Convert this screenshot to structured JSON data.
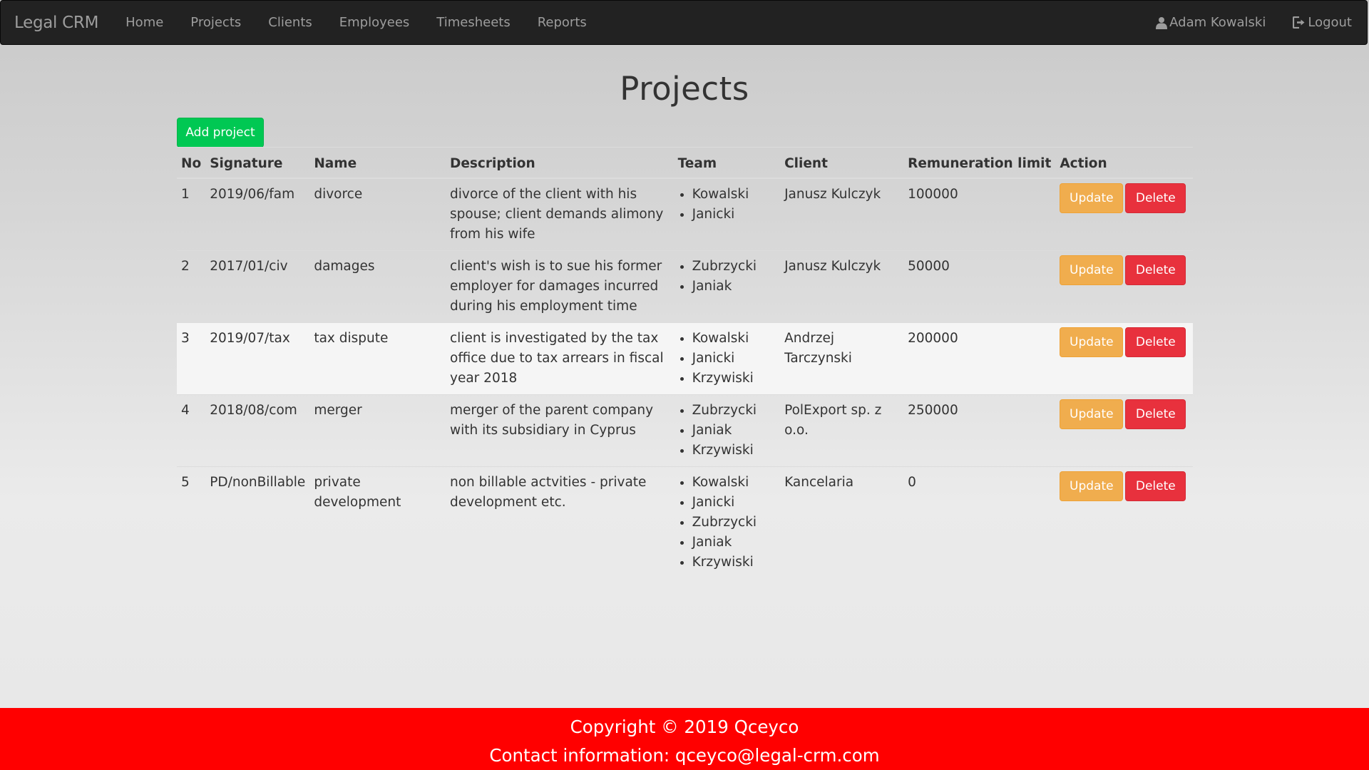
{
  "navbar": {
    "brand": "Legal CRM",
    "links": [
      "Home",
      "Projects",
      "Clients",
      "Employees",
      "Timesheets",
      "Reports"
    ],
    "user_name": "Adam Kowalski",
    "logout_label": "Logout"
  },
  "page": {
    "title": "Projects",
    "add_button_label": "Add project"
  },
  "table": {
    "headers": [
      "No",
      "Signature",
      "Name",
      "Description",
      "Team",
      "Client",
      "Remuneration limit",
      "Action"
    ],
    "rows": [
      {
        "no": "1",
        "signature": "2019/06/fam",
        "name": "divorce",
        "description": "divorce of the client with his spouse; client demands alimony from his wife",
        "team": [
          "Kowalski",
          "Janicki"
        ],
        "client": "Janusz Kulczyk",
        "limit": "100000"
      },
      {
        "no": "2",
        "signature": "2017/01/civ",
        "name": "damages",
        "description": "client's wish is to sue his former employer for damages incurred during his employment time",
        "team": [
          "Zubrzycki",
          "Janiak"
        ],
        "client": "Janusz Kulczyk",
        "limit": "50000"
      },
      {
        "no": "3",
        "signature": "2019/07/tax",
        "name": "tax dispute",
        "description": "client is investigated by the tax office due to tax arrears in fiscal year 2018",
        "team": [
          "Kowalski",
          "Janicki",
          "Krzywiski"
        ],
        "client": "Andrzej Tarczynski",
        "limit": "200000"
      },
      {
        "no": "4",
        "signature": "2018/08/com",
        "name": "merger",
        "description": "merger of the parent company with its subsidiary in Cyprus",
        "team": [
          "Zubrzycki",
          "Janiak",
          "Krzywiski"
        ],
        "client": "PolExport sp. z o.o.",
        "limit": "250000"
      },
      {
        "no": "5",
        "signature": "PD/nonBillable",
        "name": "private development",
        "description": "non billable actvities - private development etc.",
        "team": [
          "Kowalski",
          "Janicki",
          "Zubrzycki",
          "Janiak",
          "Krzywiski"
        ],
        "client": "Kancelaria",
        "limit": "0"
      }
    ],
    "update_label": "Update",
    "delete_label": "Delete"
  },
  "footer": {
    "copyright": "Copyright © 2019 Qceyco",
    "contact": "Contact information: qceyco@legal-crm.com"
  },
  "colors": {
    "navbar_bg": "#222222",
    "add_button": "#00c853",
    "update_button": "#f0ad4e",
    "delete_button": "#e8313d",
    "footer_bg": "#ff0000"
  },
  "icons": {
    "user": "user-icon",
    "logout": "logout-icon"
  }
}
